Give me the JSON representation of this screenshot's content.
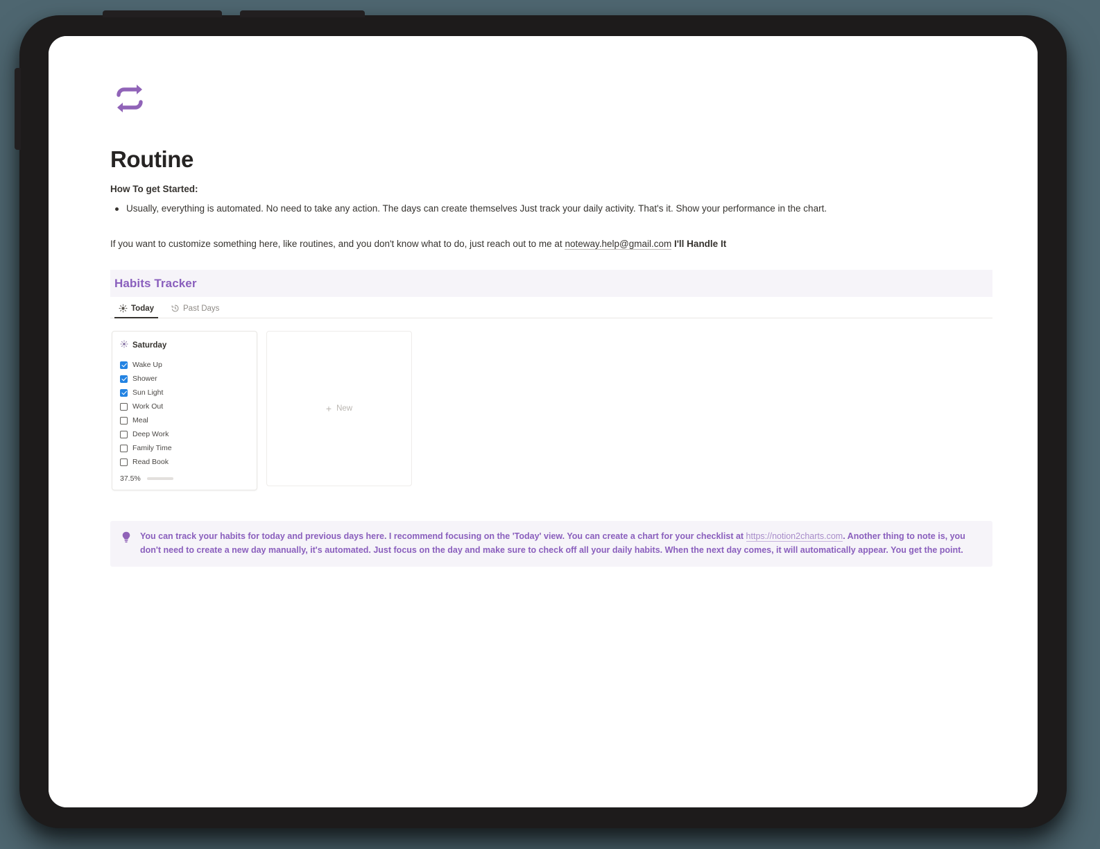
{
  "page": {
    "icon_name": "repeat-loop-icon",
    "icon_color": "#9063b8",
    "title": "Routine",
    "howto_heading": "How To get Started:",
    "bullets": [
      "Usually, everything is automated. No need to take any action. The days can create themselves  Just track your daily activity. That's it. Show your performance in the chart."
    ],
    "paragraph": {
      "before": "If you want to customize something here, like routines, and you don't know what to do, just reach out to me at ",
      "email_link": "noteway.help@gmail.com",
      "after": " I'll Handle It"
    }
  },
  "database": {
    "title": "Habits Tracker",
    "title_color": "#8a5fbd",
    "header_bg": "#f6f4f9",
    "tabs": [
      {
        "label": "Today",
        "icon": "sun-icon",
        "active": true
      },
      {
        "label": "Past Days",
        "icon": "history-clock-icon",
        "active": false
      }
    ]
  },
  "gallery": {
    "cards": [
      {
        "icon": "sun-icon",
        "title": "Saturday",
        "items": [
          {
            "label": "Wake Up",
            "checked": true
          },
          {
            "label": "Shower",
            "checked": true
          },
          {
            "label": "Sun Light",
            "checked": true
          },
          {
            "label": "Work Out",
            "checked": false
          },
          {
            "label": "Meal",
            "checked": false
          },
          {
            "label": "Deep Work",
            "checked": false
          },
          {
            "label": "Family Time",
            "checked": false
          },
          {
            "label": "Read Book",
            "checked": false
          }
        ],
        "progress_label": "37.5%",
        "progress_percent": 37.5,
        "progress_color": "#9463c4"
      }
    ],
    "new_card": {
      "plus": "+",
      "label": "New"
    }
  },
  "callout": {
    "icon": "lightbulb-icon",
    "icon_color": "#9063b8",
    "text_before": "You can track your habits for today and previous days here. I recommend focusing on the 'Today' view. You can create a chart for your checklist at ",
    "link": "https://notion2charts.com",
    "text_after": ". Another thing to note is, you don't need to create a new day manually, it's automated. Just focus on the day and make sure to check off all your daily habits. When the next day comes, it will automatically appear. You get the point.",
    "bg": "#f6f4f9",
    "text_color": "#8a5fbd"
  }
}
